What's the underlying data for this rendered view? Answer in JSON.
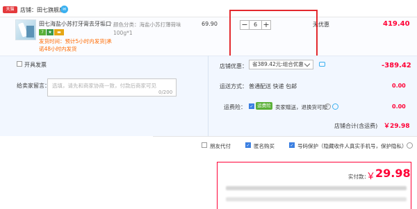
{
  "shop": {
    "logo_text": "天猫",
    "label": "店铺：田七旗舰店"
  },
  "item": {
    "title": "田七海盐小苏打牙膏去牙垢口气...",
    "badges": [
      "7",
      "★",
      "▬"
    ],
    "ship_line1": "发货时间：预计5小时内发货|承",
    "ship_line2": "诺48小时内发货",
    "sku": "颜色分类：海盐小苏打薄荷味100g*1",
    "unit_price": "69.90",
    "quantity": "6",
    "qty_minus": "−",
    "qty_plus": "+",
    "promo": "无优惠",
    "subtotal": "419.40"
  },
  "invoice": {
    "label": "开具发票"
  },
  "message": {
    "label": "给卖家留言：",
    "placeholder": "选填，请先和商家协商一致，付款后商家可见",
    "count": "0/200"
  },
  "coupon": {
    "label": "店铺优惠：",
    "selected": "省389.42元:组合优惠",
    "amount": "-389.42"
  },
  "shipping": {
    "label": "运送方式：",
    "value": "普通配送 快递 包邮",
    "amount": "0.00"
  },
  "insurance": {
    "label": "运费险：",
    "badge": "运费险",
    "text": "卖家赠送，退换货可赔",
    "amount": "0.00"
  },
  "shop_total": {
    "label": "店铺合计(含运费)",
    "amount": "￥29.98"
  },
  "options": [
    {
      "label": "朋友代付",
      "checked": false
    },
    {
      "label": "匿名购买",
      "checked": true
    },
    {
      "label": "号码保护（隐藏收件人真实手机号，保护隐私）",
      "checked": true
    }
  ],
  "payment": {
    "label": "实付款：",
    "currency": "￥",
    "amount": "29.98"
  },
  "colors": {
    "accent_red": "#ff0036",
    "highlight_rect": "#e3282d",
    "brand_blue": "#3b7fe1"
  }
}
